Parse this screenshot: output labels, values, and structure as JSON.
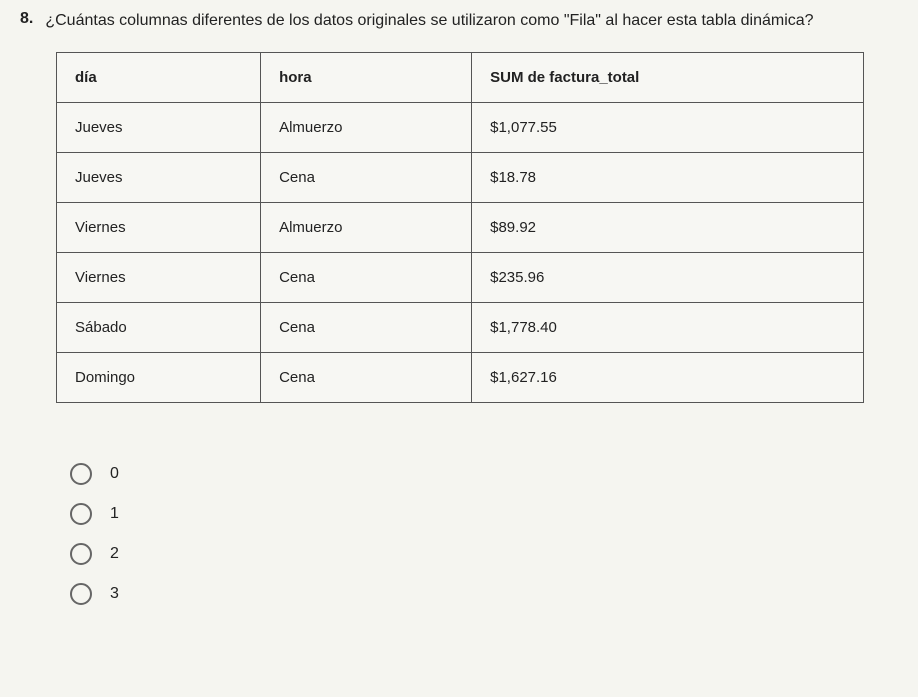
{
  "question": {
    "number": "8.",
    "text": "¿Cuántas columnas diferentes de los datos originales se utilizaron como \"Fila\" al hacer esta tabla dinámica?"
  },
  "table": {
    "headers": [
      "día",
      "hora",
      "SUM de factura_total"
    ],
    "rows": [
      [
        "Jueves",
        "Almuerzo",
        "$1,077.55"
      ],
      [
        "Jueves",
        "Cena",
        "$18.78"
      ],
      [
        "Viernes",
        "Almuerzo",
        "$89.92"
      ],
      [
        "Viernes",
        "Cena",
        "$235.96"
      ],
      [
        "Sábado",
        "Cena",
        "$1,778.40"
      ],
      [
        "Domingo",
        "Cena",
        "$1,627.16"
      ]
    ]
  },
  "options": [
    "0",
    "1",
    "2",
    "3"
  ]
}
